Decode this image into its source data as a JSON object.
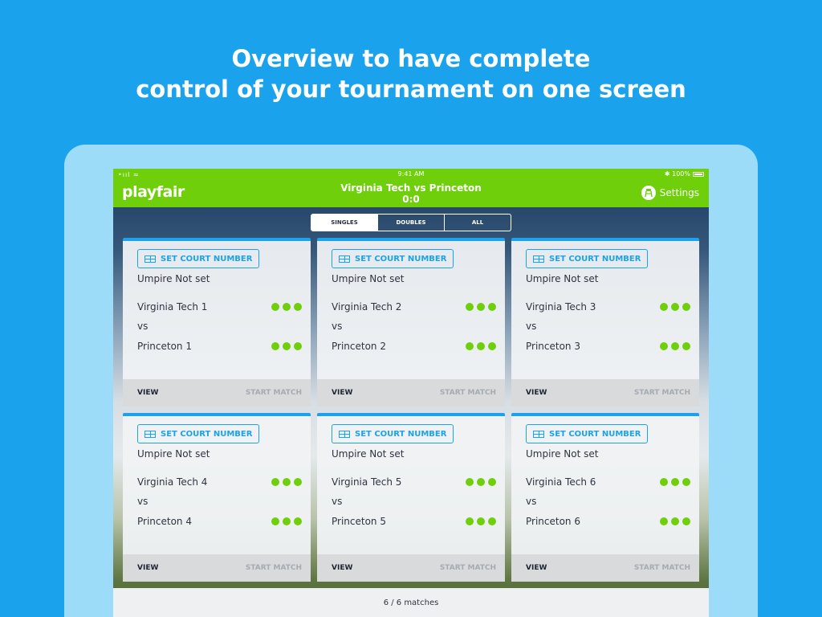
{
  "headline": {
    "line1": "Overview to have complete",
    "line2": "control of your tournament on one screen"
  },
  "status": {
    "signal": "•ııl ≈",
    "time": "9:41 AM",
    "battery": "✱ 100%"
  },
  "appbar": {
    "logo": "playfair",
    "title": "Virginia Tech vs Princeton",
    "score": "0:0",
    "settings_label": "Settings"
  },
  "tabs": [
    {
      "label": "SINGLES",
      "active": true
    },
    {
      "label": "DOUBLES",
      "active": false
    },
    {
      "label": "ALL",
      "active": false
    }
  ],
  "matches": [
    {
      "court_label": "SET COURT NUMBER",
      "umpire": "Umpire Not set",
      "team1": "Virginia Tech 1",
      "vs": "vs",
      "team2": "Princeton 1",
      "view": "VIEW",
      "start": "START MATCH"
    },
    {
      "court_label": "SET COURT NUMBER",
      "umpire": "Umpire Not set",
      "team1": "Virginia Tech 2",
      "vs": "vs",
      "team2": "Princeton 2",
      "view": "VIEW",
      "start": "START MATCH"
    },
    {
      "court_label": "SET COURT NUMBER",
      "umpire": "Umpire Not set",
      "team1": "Virginia Tech 3",
      "vs": "vs",
      "team2": "Princeton 3",
      "view": "VIEW",
      "start": "START MATCH"
    },
    {
      "court_label": "SET COURT NUMBER",
      "umpire": "Umpire Not set",
      "team1": "Virginia Tech 4",
      "vs": "vs",
      "team2": "Princeton 4",
      "view": "VIEW",
      "start": "START MATCH"
    },
    {
      "court_label": "SET COURT NUMBER",
      "umpire": "Umpire Not set",
      "team1": "Virginia Tech 5",
      "vs": "vs",
      "team2": "Princeton 5",
      "view": "VIEW",
      "start": "START MATCH"
    },
    {
      "court_label": "SET COURT NUMBER",
      "umpire": "Umpire Not set",
      "team1": "Virginia Tech 6",
      "vs": "vs",
      "team2": "Princeton 6",
      "view": "VIEW",
      "start": "START MATCH"
    }
  ],
  "footer": {
    "count": "6 / 6 matches"
  },
  "colors": {
    "background": "#1aa3ec",
    "appbar": "#6fcf0a",
    "accent": "#1aa3ec",
    "dot": "#6fcf0a"
  },
  "icons": {
    "settings": "umpire-chair-icon",
    "court": "court-grid-icon"
  }
}
